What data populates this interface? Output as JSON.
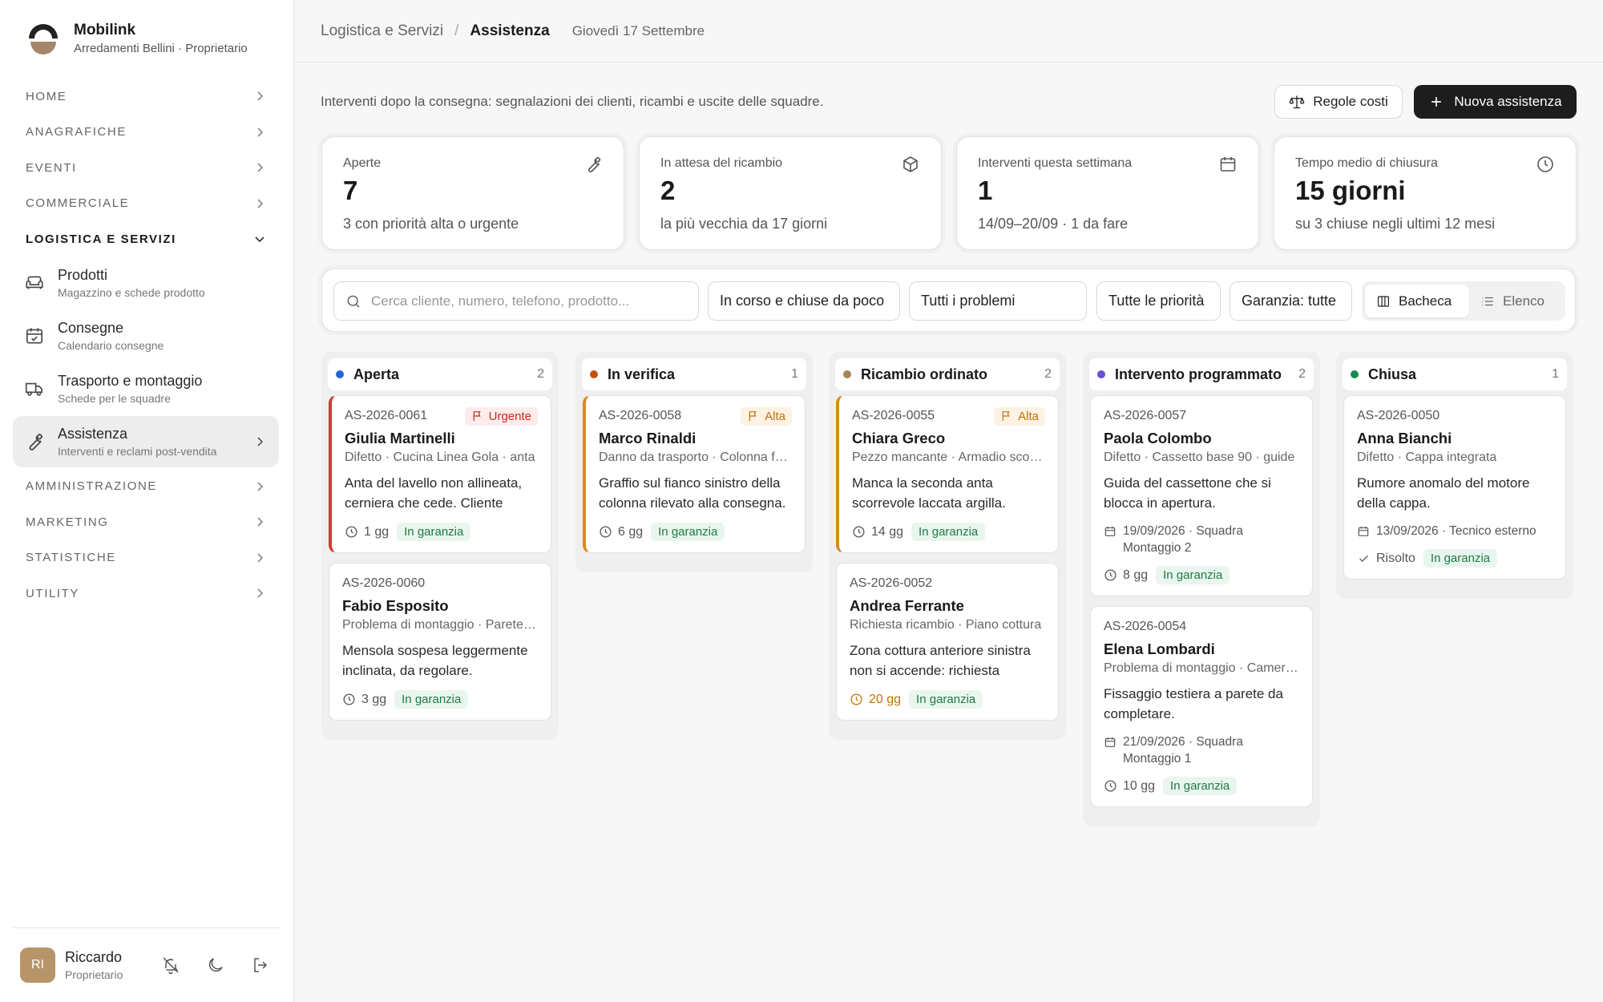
{
  "brand": {
    "name": "Mobilink",
    "subtitle": "Arredamenti Bellini · Proprietario"
  },
  "nav": {
    "sections_top": [
      {
        "label": "HOME",
        "name": "home"
      },
      {
        "label": "ANAGRAFICHE",
        "name": "anagrafiche"
      },
      {
        "label": "EVENTI",
        "name": "eventi"
      },
      {
        "label": "COMMERCIALE",
        "name": "commerciale"
      }
    ],
    "open_section": {
      "label": "LOGISTICA E SERVIZI"
    },
    "items": [
      {
        "title": "Prodotti",
        "sub": "Magazzino e schede prodotto",
        "icon": "sofa-icon"
      },
      {
        "title": "Consegne",
        "sub": "Calendario consegne",
        "icon": "calendar-check-icon"
      },
      {
        "title": "Trasporto e montaggio",
        "sub": "Schede per le squadre",
        "icon": "truck-icon"
      },
      {
        "title": "Assistenza",
        "sub": "Interventi e reclami post-vendita",
        "icon": "wrench-icon"
      }
    ],
    "sections_bottom": [
      {
        "label": "AMMINISTRAZIONE",
        "name": "amministrazione"
      },
      {
        "label": "MARKETING",
        "name": "marketing"
      },
      {
        "label": "STATISTICHE",
        "name": "statistiche"
      },
      {
        "label": "UTILITY",
        "name": "utility"
      }
    ]
  },
  "user": {
    "initials": "RI",
    "name": "Riccardo",
    "role": "Proprietario"
  },
  "header": {
    "crumb_parent": "Logistica e Servizi",
    "crumb_current": "Assistenza",
    "date": "Giovedì 17 Settembre"
  },
  "intro": "Interventi dopo la consegna: segnalazioni dei clienti, ricambi e uscite delle squadre.",
  "actions": {
    "rules": "Regole costi",
    "new": "Nuova assistenza"
  },
  "stats": [
    {
      "label": "Aperte",
      "value": "7",
      "sub": "3 con priorità alta o urgente",
      "icon": "wrench-icon"
    },
    {
      "label": "In attesa del ricambio",
      "value": "2",
      "sub": "la più vecchia da 17 giorni",
      "icon": "box-icon"
    },
    {
      "label": "Interventi questa settimana",
      "value": "1",
      "sub": "14/09–20/09 · 1 da fare",
      "icon": "calendar-icon"
    },
    {
      "label": "Tempo medio di chiusura",
      "value": "15 giorni",
      "sub": "su 3 chiuse negli ultimi 12 mesi",
      "icon": "clock-icon"
    }
  ],
  "filters": {
    "search_placeholder": "Cerca cliente, numero, telefono, prodotto...",
    "status": "In corso e chiuse da poco",
    "problems": "Tutti i problemi",
    "priority": "Tutte le priorità",
    "warranty": "Garanzia: tutte",
    "view_board": "Bacheca",
    "view_list": "Elenco"
  },
  "colors": {
    "aperta": "#2563d8",
    "verifica": "#c2520c",
    "ricambio": "#a8825a",
    "programmato": "#6d4fd6",
    "chiusa": "#178a4e"
  },
  "columns": [
    {
      "title": "Aperta",
      "count": "2",
      "color": "#2563d8",
      "cards": [
        {
          "code": "AS-2026-0061",
          "priority": "Urgente",
          "prio_class": "urgent",
          "bar": "bar-red",
          "name": "Giulia Martinelli",
          "sub": "Difetto · Cucina Linea Gola · anta",
          "desc": "Anta del lavello non allineata, cerniera che cede. Cliente molto insoddisfatta.",
          "age": "1 gg",
          "badge": "In garanzia"
        },
        {
          "code": "AS-2026-0060",
          "name": "Fabio Esposito",
          "sub": "Problema di montaggio · Parete attrezzata",
          "desc": "Mensola sospesa leggermente inclinata, da regolare.",
          "age": "3 gg",
          "badge": "In garanzia"
        }
      ]
    },
    {
      "title": "In verifica",
      "count": "1",
      "color": "#c2520c",
      "cards": [
        {
          "code": "AS-2026-0058",
          "priority": "Alta",
          "prio_class": "high",
          "bar": "bar-orange",
          "name": "Marco Rinaldi",
          "sub": "Danno da trasporto · Colonna forno",
          "desc": "Graffio sul fianco sinistro della colonna rilevato alla consegna.",
          "age": "6 gg",
          "badge": "In garanzia"
        }
      ]
    },
    {
      "title": "Ricambio ordinato",
      "count": "2",
      "color": "#a8825a",
      "cards": [
        {
          "code": "AS-2026-0055",
          "priority": "Alta",
          "prio_class": "high",
          "bar": "bar-orange",
          "name": "Chiara Greco",
          "sub": "Pezzo mancante · Armadio scorrevole",
          "desc": "Manca la seconda anta scorrevole laccata argilla.",
          "age": "14 gg",
          "badge": "In garanzia"
        },
        {
          "code": "AS-2026-0052",
          "name": "Andrea Ferrante",
          "sub": "Richiesta ricambio · Piano cottura",
          "desc": "Zona cottura anteriore sinistra non si accende: richiesta scheda.",
          "age": "20 gg",
          "age_warn": true,
          "badge": "In garanzia"
        }
      ]
    },
    {
      "title": "Intervento programmato",
      "count": "2",
      "color": "#6d4fd6",
      "cards": [
        {
          "code": "AS-2026-0057",
          "name": "Paola Colombo",
          "sub": "Difetto · Cassetto base 90 · guide",
          "desc": "Guida del cassettone che si blocca in apertura.",
          "schedule": "19/09/2026 · Squadra Montaggio 2",
          "age": "8 gg",
          "badge": "In garanzia"
        },
        {
          "code": "AS-2026-0054",
          "name": "Elena Lombardi",
          "sub": "Problema di montaggio · Camera da letto",
          "desc": "Fissaggio testiera a parete da completare.",
          "schedule": "21/09/2026 · Squadra Montaggio 1",
          "age": "10 gg",
          "badge": "In garanzia"
        }
      ]
    },
    {
      "title": "Chiusa",
      "count": "1",
      "color": "#178a4e",
      "cards": [
        {
          "code": "AS-2026-0050",
          "name": "Anna Bianchi",
          "sub": "Difetto · Cappa integrata",
          "desc": "Rumore anomalo del motore della cappa.",
          "schedule": "13/09/2026 · Tecnico esterno",
          "resolved": "Risolto",
          "badge": "In garanzia"
        }
      ]
    }
  ]
}
